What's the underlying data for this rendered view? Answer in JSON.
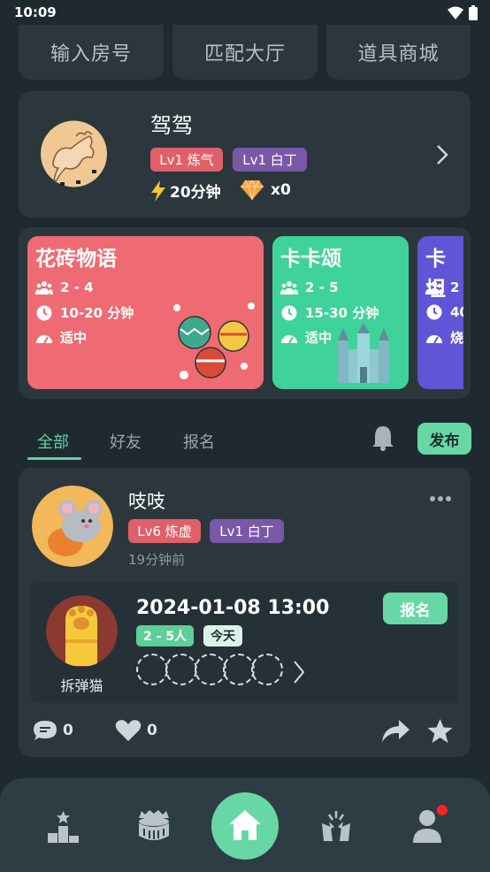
{
  "status_bar": {
    "time": "10:09"
  },
  "top_buttons": {
    "room_input": "输入房号",
    "match_hall": "匹配大厅",
    "item_shop": "道具商城"
  },
  "profile": {
    "name": "驾驾",
    "tag_level1": "Lv1 炼气",
    "tag_level2": "Lv1 白丁",
    "energy": "20分钟",
    "diamonds": "x0"
  },
  "games": [
    {
      "title": "花砖物语",
      "players": "2 - 4",
      "duration": "10-20 分钟",
      "difficulty": "适中",
      "color": "#ee6b73"
    },
    {
      "title": "卡卡颂",
      "players": "2 - 5",
      "duration": "15-30 分钟",
      "difficulty": "适中",
      "color": "#3fd29b"
    },
    {
      "title": "卡坦",
      "players": "2",
      "duration": "40",
      "difficulty": "烧",
      "color": "#6055d6"
    }
  ],
  "tabs": {
    "all": "全部",
    "friends": "好友",
    "signup": "报名",
    "publish": "发布"
  },
  "post": {
    "author": "吱吱",
    "tag1": "Lv6 炼虚",
    "tag2": "Lv1 白丁",
    "time_ago": "19分钟前",
    "event": {
      "game_name": "拆弹猫",
      "datetime": "2024-01-08 13:00",
      "players_pill": "2 - 5人",
      "day_pill": "今天",
      "signup_label": "报名"
    },
    "comments": "0",
    "likes": "0"
  },
  "colors": {
    "accent": "#5ed3a0",
    "background": "#1f2a30",
    "card": "#2b373d"
  }
}
